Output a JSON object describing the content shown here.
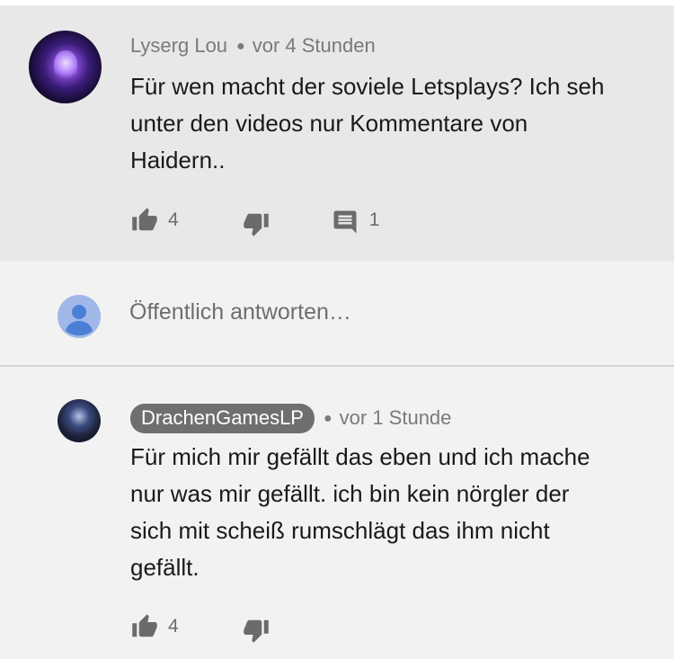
{
  "comment": {
    "author": "Lyserg Lou",
    "time": "vor 4 Stunden",
    "lines": [
      "Für wen macht der soviele Letsplays? Ich seh",
      "unter den videos nur Kommentare von",
      "Haidern.."
    ],
    "likes": "4",
    "replies": "1"
  },
  "reply_box": {
    "placeholder": "Öffentlich antworten…"
  },
  "reply": {
    "author": "DrachenGamesLP",
    "time": "vor 1 Stunde",
    "lines": [
      "Für mich mir gefällt das eben und ich mache",
      "nur was mir gefällt. ich bin kein nörgler der",
      "sich mit scheiß rumschlägt das ihm nicht",
      "gefällt."
    ],
    "likes": "4"
  },
  "icons": {
    "like": "thumbs-up-icon",
    "dislike": "thumbs-down-icon",
    "reply": "comment-icon",
    "user": "default-user-avatar"
  },
  "colors": {
    "comment_bg": "#e8e8e8",
    "page_bg": "#f2f2f2",
    "author_chip": "#6f6f6f",
    "icon": "#6b6b6b"
  }
}
